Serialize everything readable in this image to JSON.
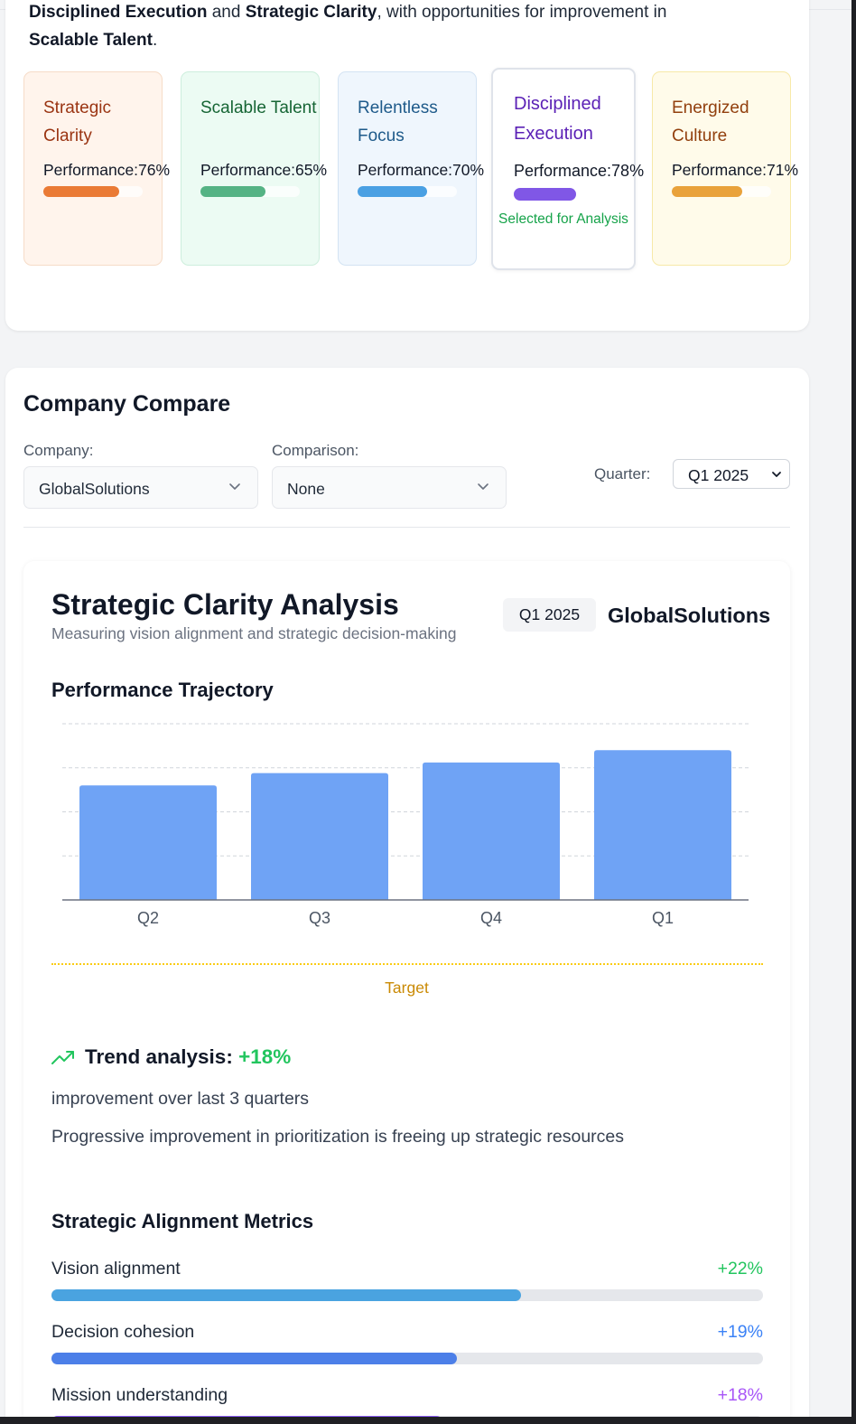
{
  "summary": {
    "line1_bold1": "Disciplined Execution",
    "line1_and": " and ",
    "line1_bold2": "Strategic Clarity",
    "line1_rest": ", with opportunities for improvement in",
    "line2_bold": "Scalable Talent",
    "line2_end": "."
  },
  "pillars": [
    {
      "name": "Strategic Clarity",
      "performance_label": "Performance:76%",
      "performance": 0.76,
      "text_color": "#9a3412",
      "bg": "#fff4ec",
      "border": "#f6dcc8",
      "bar_color": "#ea7a35"
    },
    {
      "name": "Scalable Talent",
      "performance_label": "Performance:65%",
      "performance": 0.65,
      "text_color": "#166534",
      "bg": "#ecfbf3",
      "border": "#cdeedd",
      "bar_color": "#55b384"
    },
    {
      "name": "Relentless Focus",
      "performance_label": "Performance:70%",
      "performance": 0.7,
      "text_color": "#1e5a8a",
      "bg": "#eff6fd",
      "border": "#d3e3f3",
      "bar_color": "#4aa0e3"
    },
    {
      "name": "Disciplined Execution",
      "performance_label": "Performance:78%",
      "performance": 0.78,
      "text_color": "#5b21b6",
      "bg": "#ffffff",
      "border": "#dfe3ea",
      "bar_color": "#8057e6",
      "selected_text": "Selected for Analysis"
    },
    {
      "name": "Energized Culture",
      "performance_label": "Performance:71%",
      "performance": 0.71,
      "text_color": "#92400e",
      "bg": "#fffbea",
      "border": "#f7e9a8",
      "bar_color": "#e9a23b"
    }
  ],
  "compare": {
    "title": "Company Compare",
    "company_label": "Company:",
    "company_value": "GlobalSolutions",
    "comparison_label": "Comparison:",
    "comparison_value": "None",
    "quarter_label": "Quarter:",
    "quarter_value": "Q1 2025"
  },
  "analysis": {
    "title": "Strategic Clarity Analysis",
    "subtitle": "Measuring vision alignment and strategic decision-making",
    "quarter_badge": "Q1 2025",
    "company": "GlobalSolutions",
    "trajectory_title": "Performance Trajectory",
    "target_label": "Target",
    "trend_label": "Trend analysis: ",
    "trend_value": "+18%",
    "trend_line1": "improvement over last 3 quarters",
    "trend_line2": "Progressive improvement in prioritization is freeing up strategic resources",
    "metrics_title": "Strategic Alignment Metrics",
    "metrics": [
      {
        "label": "Vision alignment",
        "value": "+22%",
        "fill": 0.66,
        "value_color": "#22c55e",
        "bar_color": "#4aa3e0"
      },
      {
        "label": "Decision cohesion",
        "value": "+19%",
        "fill": 0.57,
        "value_color": "#3b82f6",
        "bar_color": "#4c7fe8"
      },
      {
        "label": "Mission understanding",
        "value": "+18%",
        "fill": 0.55,
        "value_color": "#a855f7",
        "bar_color": "#8b5cf6"
      }
    ]
  },
  "chart_data": {
    "type": "bar",
    "categories": [
      "Q2",
      "Q3",
      "Q4",
      "Q1"
    ],
    "values": [
      65,
      72,
      78,
      85
    ],
    "ylim": [
      0,
      100
    ],
    "grid": true,
    "bar_color": "#6fa3f5",
    "title": "",
    "xlabel": "",
    "ylabel": ""
  },
  "icons": {
    "trend": "trending-up-icon",
    "dropdown": "chevron-down-icon"
  }
}
